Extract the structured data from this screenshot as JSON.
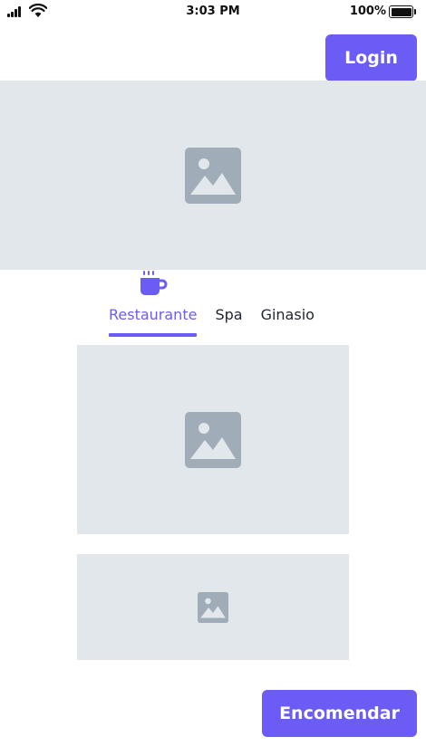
{
  "status_bar": {
    "time": "3:03 PM",
    "battery_percent": "100%",
    "icons": [
      "signal-icon",
      "wifi-icon",
      "battery-icon"
    ]
  },
  "header": {
    "login_label": "Login"
  },
  "tabs": {
    "icon": "coffee-icon",
    "items": [
      {
        "label": "Restaurante",
        "active": true
      },
      {
        "label": "Spa",
        "active": false
      },
      {
        "label": "Ginasio",
        "active": false
      }
    ]
  },
  "placeholders": {
    "icon": "image-icon"
  },
  "footer": {
    "order_label": "Encomendar"
  },
  "colors": {
    "accent": "#6b5cf5",
    "placeholder_bg": "#e2e7ec",
    "placeholder_icon": "#a0acb8",
    "text": "#1f2430"
  }
}
